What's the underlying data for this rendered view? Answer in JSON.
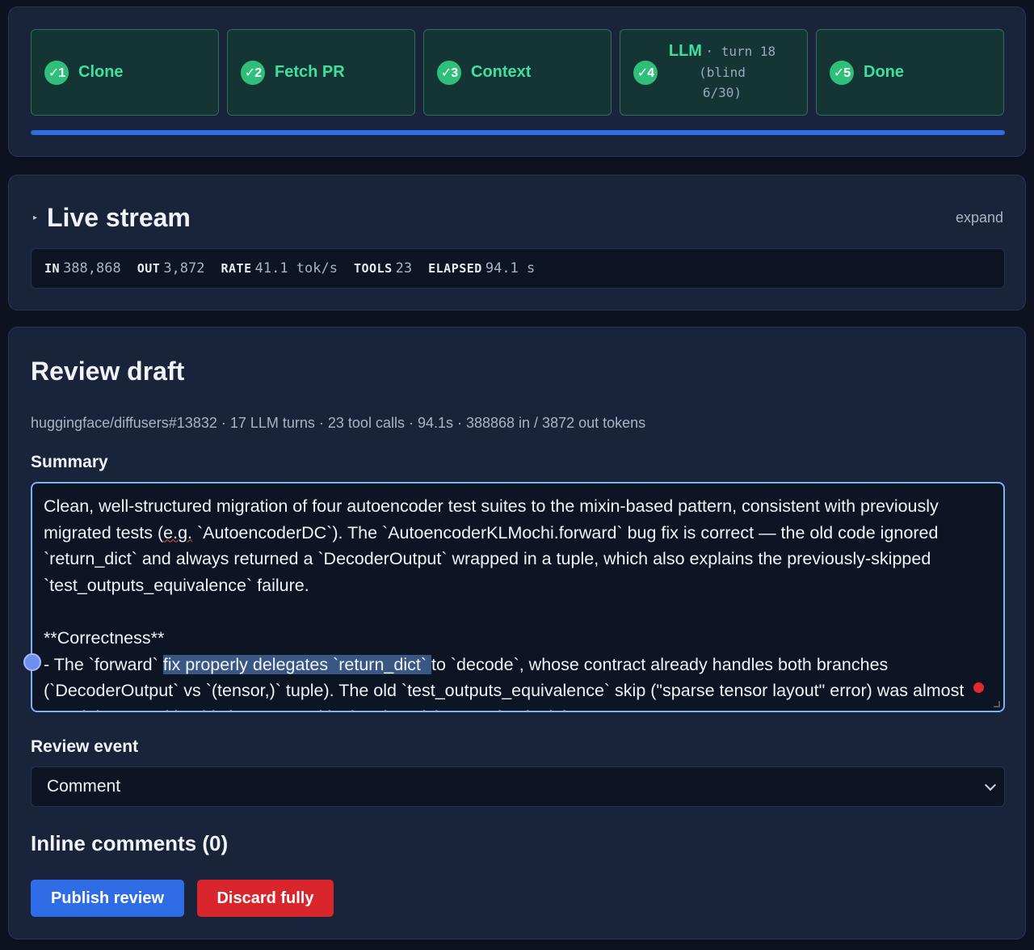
{
  "pipeline": {
    "steps": [
      {
        "number": "✓1",
        "label": "Clone"
      },
      {
        "number": "✓2",
        "label": "Fetch PR"
      },
      {
        "number": "✓3",
        "label": "Context"
      },
      {
        "number": "✓4",
        "label": "LLM",
        "detail_line1": "· turn 18",
        "detail_line2": "(blind",
        "detail_line3": "6/30)"
      },
      {
        "number": "✓5",
        "label": "Done"
      }
    ],
    "progress_fraction": 1.0,
    "colors": {
      "step_bg": "#153535",
      "step_label": "#3ee0a0",
      "badge": "#2fbf7a",
      "progress": "#2f6de6"
    }
  },
  "live_stream": {
    "title": "Live stream",
    "expand_label": "expand",
    "stats": [
      {
        "key": "IN",
        "value": "388,868"
      },
      {
        "key": "OUT",
        "value": "3,872"
      },
      {
        "key": "RATE",
        "value": "41.1 tok/s"
      },
      {
        "key": "TOOLS",
        "value": "23"
      },
      {
        "key": "ELAPSED",
        "value": "94.1 s"
      }
    ]
  },
  "review": {
    "title": "Review draft",
    "meta": "huggingface/diffusers#13832 · 17 LLM turns · 23 tool calls · 94.1s · 388868 in / 3872 out tokens",
    "summary_label": "Summary",
    "summary_parts": {
      "p1a": "Clean, well-structured migration of four autoencoder test suites to the mixin-based pattern, consistent with previously migrated tests (",
      "p1_spell": "e.g.",
      "p1b": " `AutoencoderDC`). The `AutoencoderKLMochi.forward` bug fix is correct — the old code ignored `return_dict` and always returned a `DecoderOutput` wrapped in a tuple, which also explains the previously-skipped `test_outputs_equivalence` failure.\n\n**Correctness**\n- The `forward` ",
      "highlight": "fix properly delegates `return_dict` ",
      "p2": "to `decode`, whose contract already handles both branches (`DecoderOutput` vs `(tensor,)` tuple). The old `test_outputs_equivalence` skip (\"sparse tensor layout\" error) was almost certainly caused by this bug, so unskipping the mixin's version is right."
    },
    "event_label": "Review event",
    "event_value": "Comment",
    "inline_title": "Inline comments (0)",
    "publish_label": "Publish review",
    "discard_label": "Discard fully",
    "colors": {
      "publish": "#2f6de6",
      "discard": "#d9262c",
      "summary_border": "#7fb0f0"
    }
  }
}
